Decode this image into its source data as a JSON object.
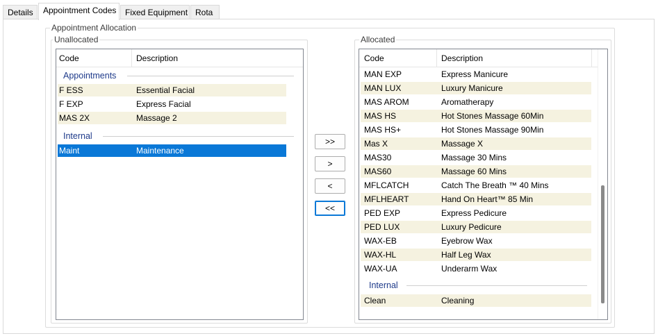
{
  "tabs": [
    {
      "label": "Details",
      "active": false
    },
    {
      "label": "Appointment Codes",
      "active": true
    },
    {
      "label": "Fixed Equipment",
      "active": false
    },
    {
      "label": "Rota",
      "active": false
    }
  ],
  "appointment_allocation": {
    "title": "Appointment Allocation",
    "unallocated": {
      "title": "Unallocated",
      "columns": {
        "code": "Code",
        "description": "Description"
      },
      "groups": [
        {
          "name": "Appointments",
          "rows": [
            {
              "code": "F ESS",
              "description": "Essential Facial"
            },
            {
              "code": "F EXP",
              "description": "Express Facial"
            },
            {
              "code": "MAS 2X",
              "description": "Massage 2"
            }
          ]
        },
        {
          "name": "Internal",
          "rows": [
            {
              "code": "Maint",
              "description": "Maintenance",
              "selected": true
            }
          ]
        }
      ]
    },
    "buttons": {
      "add_all": ">>",
      "add": ">",
      "remove": "<",
      "remove_all": "<<"
    },
    "allocated": {
      "title": "Allocated",
      "columns": {
        "code": "Code",
        "description": "Description"
      },
      "rows": [
        {
          "code": "MAN EXP",
          "description": "Express Manicure"
        },
        {
          "code": "MAN LUX",
          "description": "Luxury Manicure"
        },
        {
          "code": "MAS AROM",
          "description": "Aromatherapy"
        },
        {
          "code": "MAS HS",
          "description": "Hot Stones Massage 60Min"
        },
        {
          "code": "MAS HS+",
          "description": "Hot Stones Massage 90Min"
        },
        {
          "code": "Mas X",
          "description": "Massage X"
        },
        {
          "code": "MAS30",
          "description": "Massage 30 Mins"
        },
        {
          "code": "MAS60",
          "description": "Massage 60 Mins"
        },
        {
          "code": "MFLCATCH",
          "description": "Catch The Breath ™ 40 Mins"
        },
        {
          "code": "MFLHEART",
          "description": "Hand On Heart™ 85 Min"
        },
        {
          "code": "PED EXP",
          "description": "Express Pedicure"
        },
        {
          "code": "PED LUX",
          "description": "Luxury Pedicure"
        },
        {
          "code": "WAX-EB",
          "description": "Eyebrow Wax"
        },
        {
          "code": "WAX-HL",
          "description": "Half Leg Wax"
        },
        {
          "code": "WAX-UA",
          "description": "Underarm Wax"
        }
      ],
      "internal_group": {
        "name": "Internal",
        "rows": [
          {
            "code": "Clean",
            "description": "Cleaning"
          }
        ]
      }
    }
  },
  "colors": {
    "row_shade": "#f5f2e0",
    "selection": "#0a78d7",
    "group_header_text": "#1e3a8a"
  }
}
